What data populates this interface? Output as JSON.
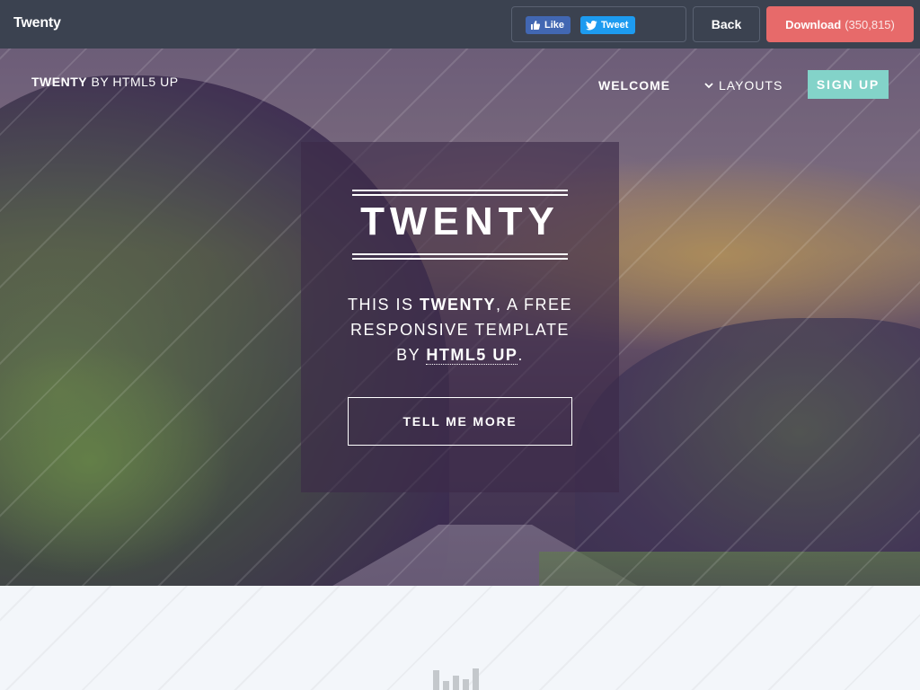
{
  "topbar": {
    "title": "Twenty",
    "like_label": "Like",
    "tweet_label": "Tweet",
    "back_label": "Back",
    "download_label": "Download",
    "download_count": "(350,815)"
  },
  "hero": {
    "brand_bold": "TWENTY",
    "brand_rest": "BY HTML5 UP",
    "nav": {
      "welcome": "WELCOME",
      "layouts": "LAYOUTS",
      "signup": "SIGN UP"
    },
    "card": {
      "title": "TWENTY",
      "tagline_1": "THIS IS ",
      "tagline_bold": "TWENTY",
      "tagline_2": ", A FREE",
      "tagline_3": "RESPONSIVE TEMPLATE",
      "tagline_4": "BY ",
      "tagline_link": "HTML5 UP",
      "tagline_end": ".",
      "button": "TELL ME MORE"
    }
  },
  "icons": {
    "facebook": "facebook-thumb-icon",
    "twitter": "twitter-bird-icon",
    "chevron": "chevron-down-icon",
    "chart": "bar-chart-icon"
  },
  "colors": {
    "topbar_bg": "#3b4250",
    "download_bg": "#e76a6a",
    "signup_bg": "#83d3c9",
    "facebook": "#4267b2",
    "twitter": "#1d9bf0",
    "lower_bg": "#f3f6fa"
  }
}
